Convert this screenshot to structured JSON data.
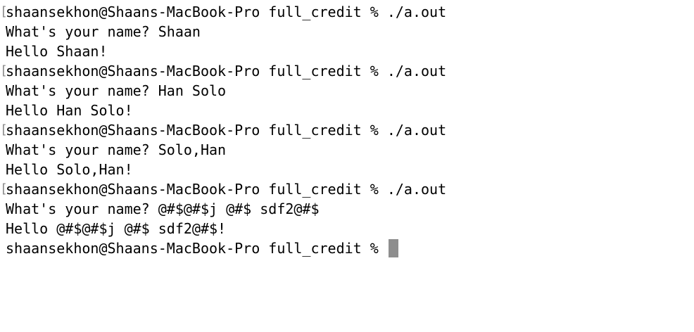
{
  "terminal": {
    "marker": "[",
    "lines": [
      {
        "text": "shaansekhon@Shaans-MacBook-Pro full_credit % ./a.out",
        "marked": true
      },
      {
        "text": "What's your name? Shaan",
        "marked": false
      },
      {
        "text": "Hello Shaan!",
        "marked": false
      },
      {
        "text": "shaansekhon@Shaans-MacBook-Pro full_credit % ./a.out",
        "marked": true
      },
      {
        "text": "What's your name? Han Solo",
        "marked": false
      },
      {
        "text": "Hello Han Solo!",
        "marked": false
      },
      {
        "text": "shaansekhon@Shaans-MacBook-Pro full_credit % ./a.out",
        "marked": true
      },
      {
        "text": "What's your name? Solo,Han",
        "marked": false
      },
      {
        "text": "Hello Solo,Han!",
        "marked": false
      },
      {
        "text": "shaansekhon@Shaans-MacBook-Pro full_credit % ./a.out",
        "marked": true
      },
      {
        "text": "What's your name? @#$@#$j @#$ sdf2@#$",
        "marked": false
      },
      {
        "text": "Hello @#$@#$j @#$ sdf2@#$!",
        "marked": false
      }
    ],
    "current_prompt": "shaansekhon@Shaans-MacBook-Pro full_credit % "
  }
}
